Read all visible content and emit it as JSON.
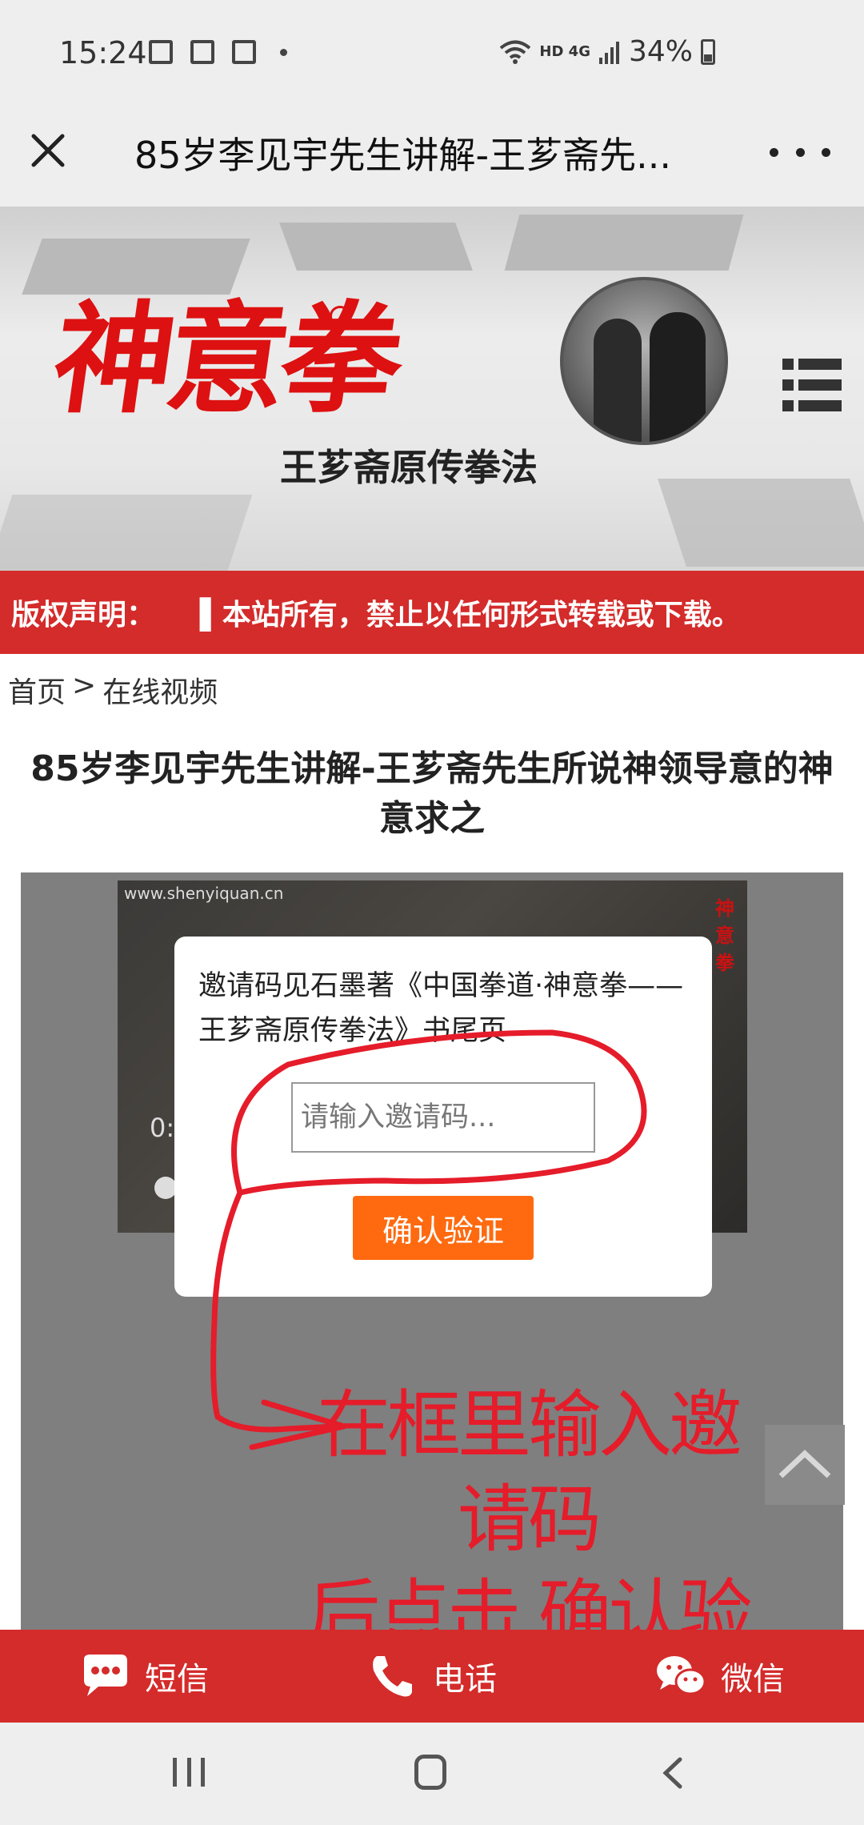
{
  "status_bar": {
    "time": "15:24",
    "network": "HD 4G",
    "battery": "34%"
  },
  "title_bar": {
    "title": "85岁李见宇先生讲解-王芗斋先..."
  },
  "hero": {
    "logo_text": "神意拳",
    "logo_sub": "王芗斋原传拳法"
  },
  "notice": {
    "label": "版权声明：",
    "text": "▌本站所有，禁止以任何形式转载或下载。"
  },
  "breadcrumb": {
    "home": "首页",
    "separator": ">",
    "current": "在线视频"
  },
  "article": {
    "title": "85岁李见宇先生讲解-王芗斋先生所说神领导意的神意求之"
  },
  "video": {
    "watermark": "www.shenyiquan.cn",
    "stamp": "神意拳",
    "time_partial": "0:"
  },
  "modal": {
    "message": "邀请码见石墨著《中国拳道·神意拳——王芗斋原传拳法》书尾页",
    "input_placeholder": "请输入邀请码...",
    "confirm_label": "确认验证"
  },
  "annotation": {
    "line1": "在框里输入邀请码",
    "line2": "后点击.确认验证."
  },
  "contact_bar": {
    "sms": "短信",
    "phone": "电话",
    "wechat": "微信"
  },
  "colors": {
    "accent_red": "#d42b2b",
    "button_orange": "#ff6a10",
    "annotation_red": "#e51c2a"
  }
}
